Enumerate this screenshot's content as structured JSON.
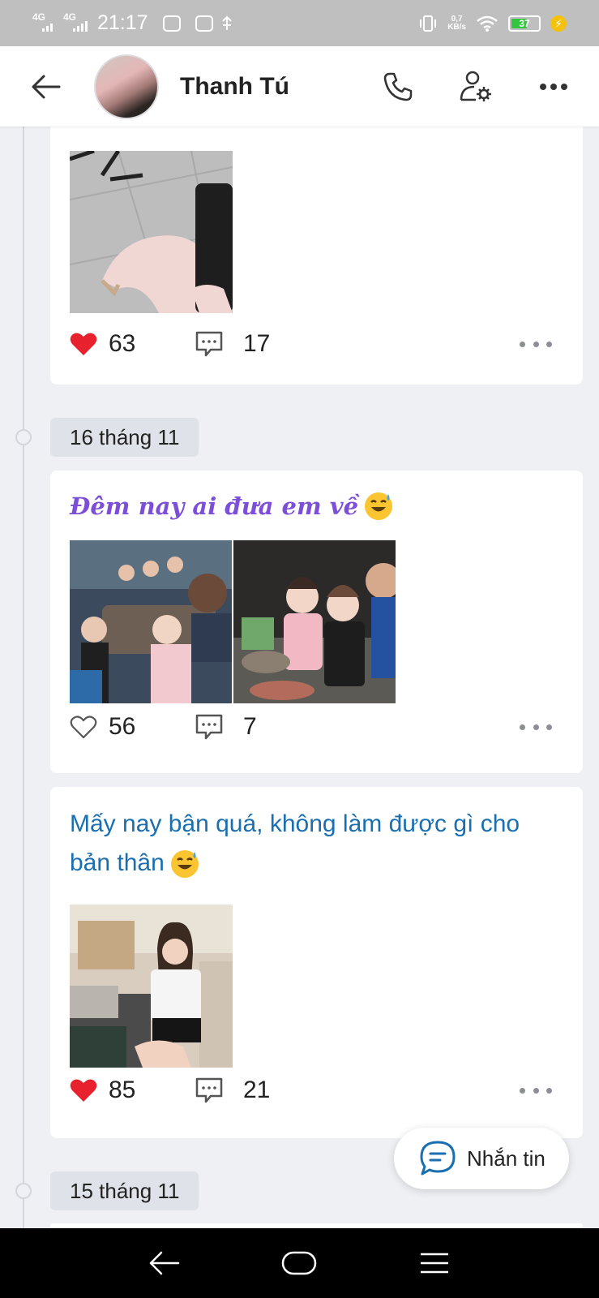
{
  "status_bar": {
    "net1": "4G",
    "net2": "4G",
    "time": "21:17",
    "speed_value": "0,7",
    "speed_unit": "KB/s",
    "battery": "37"
  },
  "header": {
    "contact_name": "Thanh Tú"
  },
  "posts": [
    {
      "likes": "63",
      "liked": true,
      "comments": "17"
    },
    {
      "date": "16 tháng 11",
      "text": "Đêm nay ai đưa em về",
      "likes": "56",
      "liked": false,
      "comments": "7"
    },
    {
      "text": "Mấy nay bận quá, không làm được gì cho bản thân",
      "likes": "85",
      "liked": true,
      "comments": "21"
    }
  ],
  "next_date": "15 tháng 11",
  "message_button": {
    "label": "Nhắn tin"
  },
  "colors": {
    "heart": "#e8212e",
    "script_text": "#7d4fd8",
    "blue_text": "#1a6fb0",
    "accent": "#1a6fb0"
  }
}
